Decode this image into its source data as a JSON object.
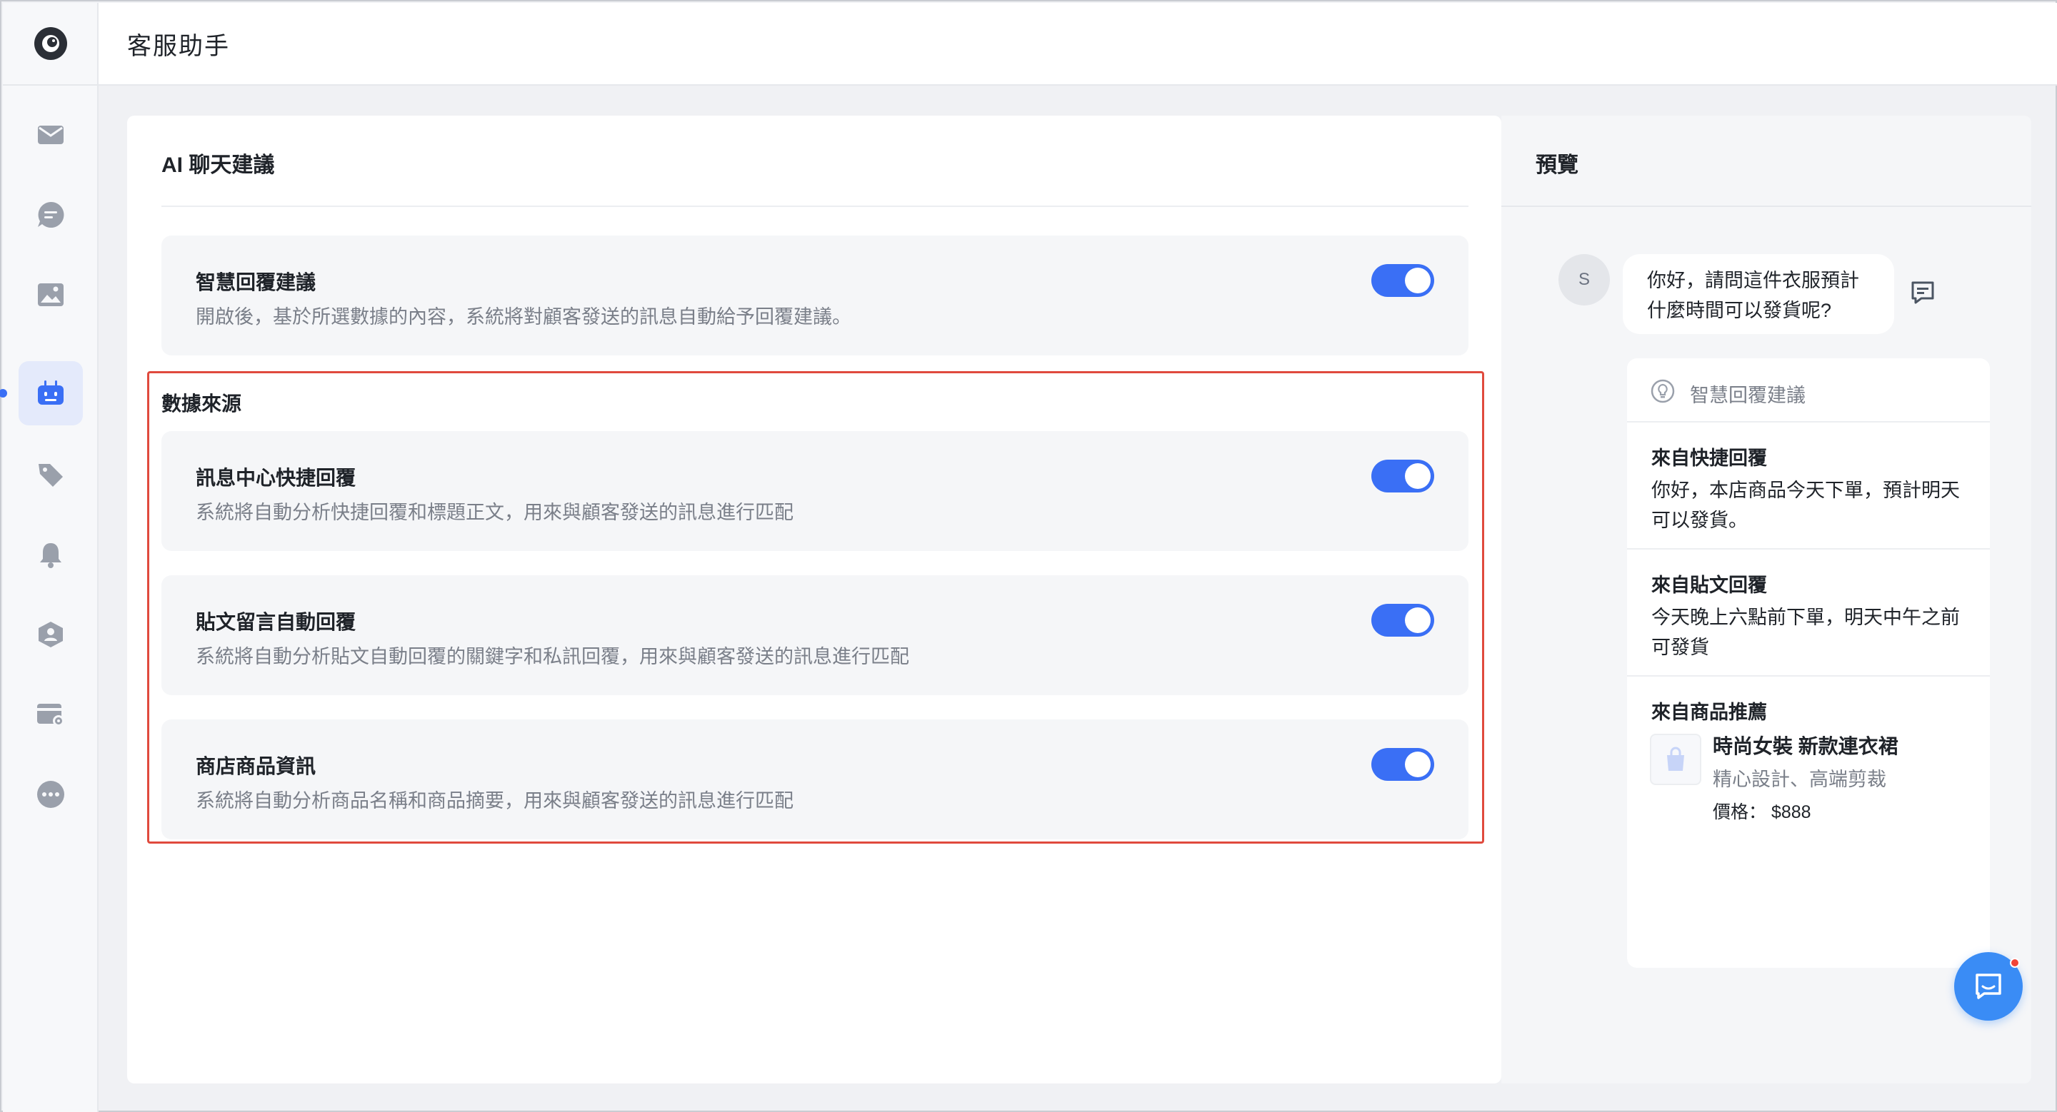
{
  "header": {
    "title": "客服助手"
  },
  "sidebar": {
    "items": [
      {
        "icon": "mail-icon"
      },
      {
        "icon": "chat-icon"
      },
      {
        "icon": "image-icon"
      },
      {
        "icon": "robot-icon",
        "active": true
      },
      {
        "icon": "tag-icon"
      },
      {
        "icon": "bell-icon"
      },
      {
        "icon": "user-shield-icon"
      },
      {
        "icon": "card-settings-icon"
      },
      {
        "icon": "more-icon"
      }
    ]
  },
  "main": {
    "title": "AI 聊天建議",
    "smart_reply": {
      "title": "智慧回覆建議",
      "desc": "開啟後，基於所選數據的內容，系統將對顧客發送的訊息自動給予回覆建議。",
      "enabled": true
    },
    "data_source_label": "數據來源",
    "sources": [
      {
        "title": "訊息中心快捷回覆",
        "desc": "系統將自動分析快捷回覆和標題正文，用來與顧客發送的訊息進行匹配",
        "enabled": true
      },
      {
        "title": "貼文留言自動回覆",
        "desc": "系統將自動分析貼文自動回覆的關鍵字和私訊回覆，用來與顧客發送的訊息進行匹配",
        "enabled": true
      },
      {
        "title": "商店商品資訊",
        "desc": "系統將自動分析商品名稱和商品摘要，用來與顧客發送的訊息進行匹配",
        "enabled": true
      }
    ]
  },
  "preview": {
    "title": "預覽",
    "avatar": "S",
    "customer_message": "你好，請問這件衣服預計什麼時間可以發貨呢?",
    "suggest_header": "智慧回覆建議",
    "suggestions": [
      {
        "title": "來自快捷回覆",
        "text": "你好，本店商品今天下單，預計明天可以發貨。"
      },
      {
        "title": "來自貼文回覆",
        "text": "今天晚上六點前下單，明天中午之前可發貨"
      }
    ],
    "product_suggestion": {
      "title": "來自商品推薦",
      "name": "時尚女裝 新款連衣裙",
      "desc": "精心設計、高端剪裁",
      "price": "價格：  $888"
    }
  },
  "colors": {
    "accent": "#3a6ff5",
    "highlight": "#e04a3d"
  }
}
